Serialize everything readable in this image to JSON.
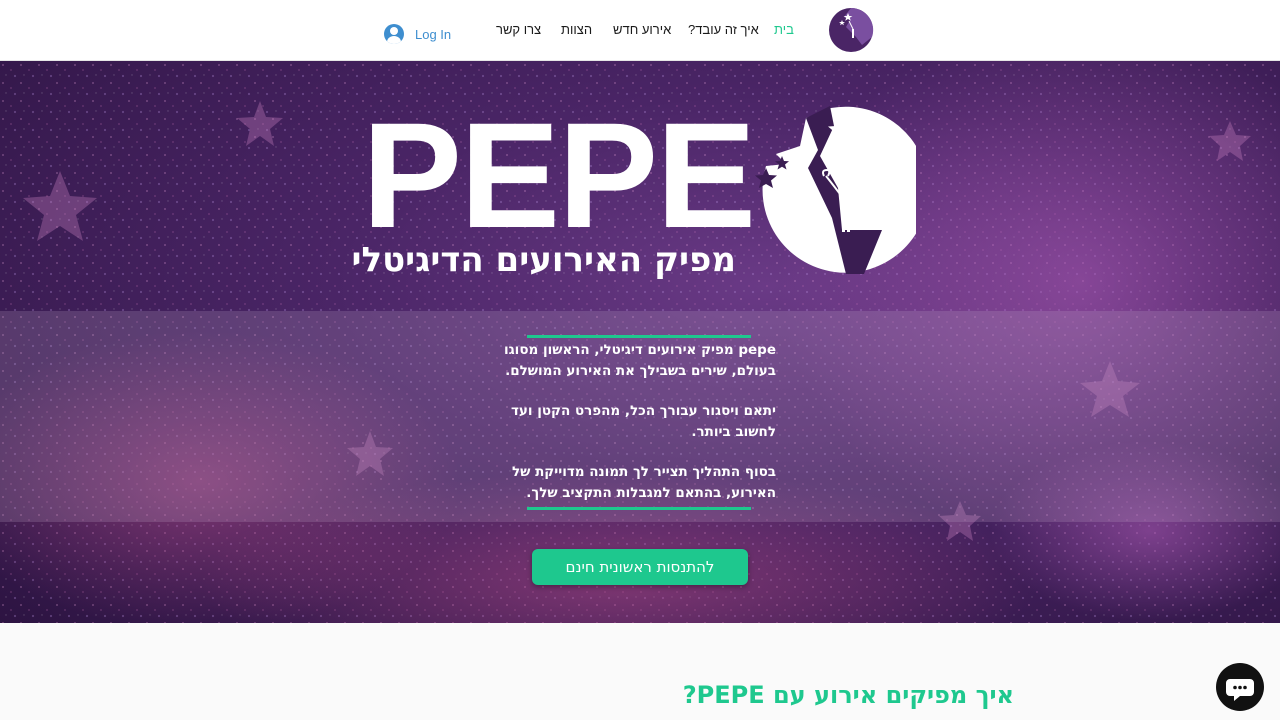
{
  "header": {
    "login_label": "Log In",
    "nav": [
      {
        "label": "בית",
        "active": true
      },
      {
        "label": "איך זה עובד?",
        "active": false
      },
      {
        "label": "אירוע חדש",
        "active": false
      },
      {
        "label": "הצוות",
        "active": false
      },
      {
        "label": "צרו קשר",
        "active": false
      }
    ],
    "logo_icon": "pepe-moon-logo-icon"
  },
  "hero": {
    "brand_word": "PEPE",
    "tagline": "מפיק האירועים הדיגיטלי",
    "panel_paragraphs": [
      "pepe מפיק אירועים דיגיטלי, הראשון מסוגו בעולם, שירים בשבילך את האירוע המושלם.",
      "יתאם ויסגור עבורך הכל, מהפרט הקטן ועד לחשוב ביותר.",
      "בסוף התהליך תצייר לך תמונה מדוייקת של האירוע, בהתאם למגבלות התקציב שלך."
    ],
    "cta_label": "להתנסות ראשונית חינם"
  },
  "section": {
    "title": "איך מפיקים אירוע עם PEPE?"
  },
  "colors": {
    "accent": "#1ec88e",
    "login": "#3e8ecf",
    "hero_dark": "#2d1442",
    "hero_mid": "#6a3a86"
  },
  "icons": {
    "login": "user-avatar-icon",
    "chat": "chat-bubble-icon"
  }
}
